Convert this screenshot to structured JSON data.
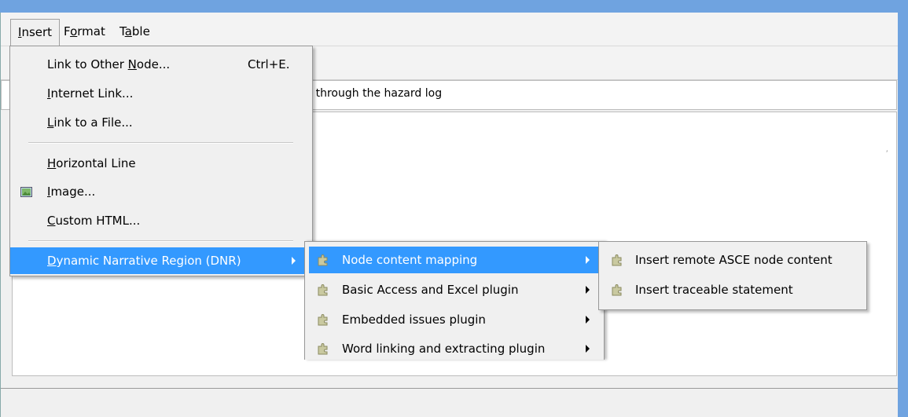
{
  "menubar": {
    "items": [
      {
        "label": "Insert",
        "accel": "I"
      },
      {
        "label": "Format",
        "accel": "o"
      },
      {
        "label": "Table",
        "accel": "a"
      }
    ]
  },
  "editor": {
    "text_line": "ly through the hazard log"
  },
  "insert_menu": {
    "items": [
      {
        "label_pre": "Link to Other ",
        "label_ul": "N",
        "label_post": "ode...",
        "shortcut": "Ctrl+E."
      },
      {
        "label_pre": "",
        "label_ul": "I",
        "label_post": "nternet Link...",
        "shortcut": ""
      },
      {
        "label_pre": "",
        "label_ul": "L",
        "label_post": "ink to a File...",
        "shortcut": ""
      },
      {
        "label_pre": "",
        "label_ul": "H",
        "label_post": "orizontal Line",
        "shortcut": ""
      },
      {
        "label_pre": "",
        "label_ul": "I",
        "label_post": "mage...",
        "shortcut": ""
      },
      {
        "label_pre": "",
        "label_ul": "C",
        "label_post": "ustom HTML...",
        "shortcut": ""
      },
      {
        "label_pre": "",
        "label_ul": "D",
        "label_post": "ynamic Narrative Region (DNR)",
        "shortcut": ""
      }
    ]
  },
  "dnr_menu": {
    "items": [
      {
        "label": "Node content mapping"
      },
      {
        "label": "Basic Access and Excel plugin"
      },
      {
        "label": "Embedded issues plugin"
      },
      {
        "label": "Word linking and extracting plugin"
      }
    ]
  },
  "mapping_menu": {
    "items": [
      {
        "label": "Insert remote ASCE node content"
      },
      {
        "label": "Insert traceable statement"
      }
    ]
  },
  "colors": {
    "highlight": "#3399ff",
    "title_bar": "#6fa3e0",
    "menu_bg": "#f0f0f0"
  }
}
